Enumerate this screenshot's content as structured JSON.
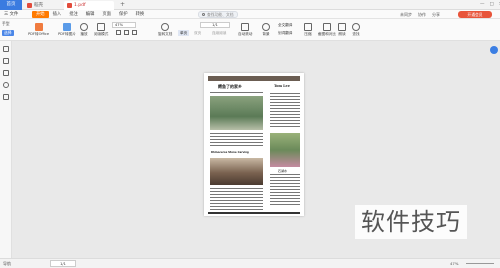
{
  "titlebar": {
    "home_tab": "首页",
    "tab1": "稻壳",
    "tab2": "1.pdf",
    "add": "+"
  },
  "menubar": {
    "file": "三 文件",
    "tabs": [
      "开始",
      "插入",
      "批注",
      "编辑",
      "页面",
      "保护",
      "转换"
    ],
    "active_tab": "开始",
    "search_placeholder": "查找功能、文档",
    "right_items": [
      "未同步",
      "协作",
      "分享"
    ],
    "upgrade": "开通会员"
  },
  "toolbar": {
    "hand": "手型",
    "select": "选择",
    "pdf_to_office": "PDF转Office",
    "pdf_to_image": "PDF转图片",
    "play": "播放",
    "read_mode": "阅读模式",
    "zoom": "47%",
    "page": "1/1",
    "rotate": "旋转文档",
    "single_page": "单页",
    "double_page": "双页",
    "continuous": "连续阅读",
    "auto_scroll": "自动滚动",
    "background": "背景",
    "full_translate": "全文翻译",
    "word_translate": "划词翻译",
    "compress": "压缩",
    "screenshot_compare": "截图和对比",
    "read_aloud": "朗读",
    "find": "查找"
  },
  "page": {
    "headline_left": "鳄鱼了的家乡",
    "headline_right": "Tom   Lee",
    "section_title": "Rhinoceros Stone Carving",
    "side_title": "石湖水"
  },
  "statusbar": {
    "nav": "导航",
    "page_indicator": "1/1",
    "zoom": "47%"
  },
  "watermark": "软件技巧",
  "colors": {
    "accent": "#ff7a00",
    "home_tab": "#3a7be0",
    "upgrade": "#e8543a"
  }
}
